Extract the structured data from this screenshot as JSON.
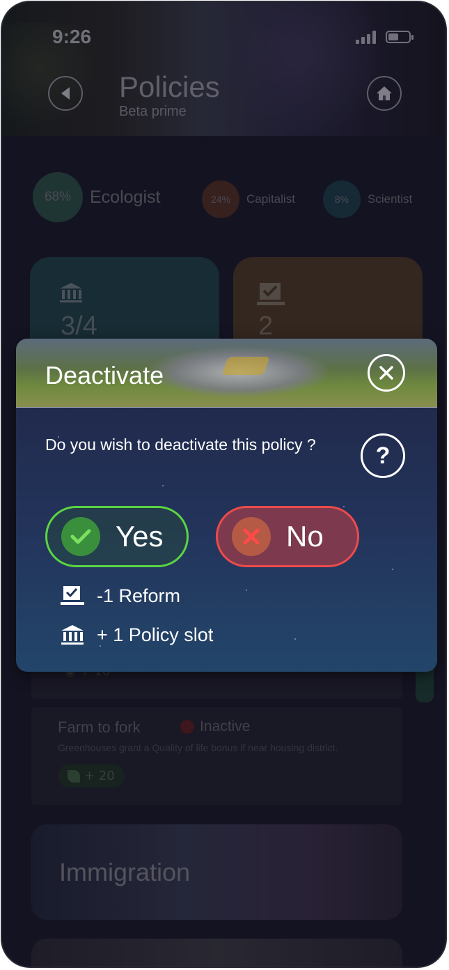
{
  "status_bar": {
    "time": "9:26"
  },
  "header": {
    "title": "Policies",
    "subtitle": "Beta prime",
    "back_icon": "back-arrow-icon",
    "home_icon": "home-icon"
  },
  "factions": [
    {
      "percent": "68%",
      "name": "Ecologist",
      "color": "#2b4d47"
    },
    {
      "percent": "24%",
      "name": "Capitalist",
      "color": "#4f2f27"
    },
    {
      "percent": "8%",
      "name": "Scientist",
      "color": "#1e3c4a"
    }
  ],
  "stats": [
    {
      "icon": "bank-icon",
      "value": "3/4"
    },
    {
      "icon": "checkbox-tray-icon",
      "value": "2"
    }
  ],
  "policies": [
    {
      "chip": "+ 10",
      "chip_icon": "coins-icon"
    },
    {
      "name": "Farm to fork",
      "state": "Inactive",
      "description": "Greenhouses grant a Quality of life bonus if near housing district.",
      "bonus": "+ 20",
      "bonus_icon": "leaf-icon"
    }
  ],
  "sections": {
    "immigration": "Immigration"
  },
  "modal": {
    "title": "Deactivate",
    "question": "Do you wish to deactivate this policy ?",
    "yes_label": "Yes",
    "no_label": "No",
    "effects": [
      {
        "icon": "checkbox-tray-icon",
        "text": "-1 Reform"
      },
      {
        "icon": "bank-icon",
        "text": "+ 1 Policy slot"
      }
    ],
    "colors": {
      "yes_border": "#5bd443",
      "no_border": "#ec4b4b"
    }
  }
}
